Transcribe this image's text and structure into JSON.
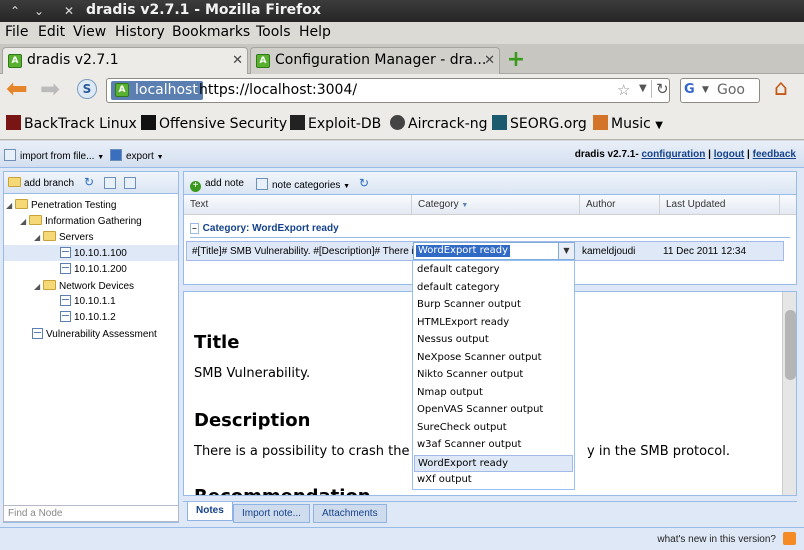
{
  "window": {
    "title": "dradis v2.7.1 - Mozilla Firefox"
  },
  "menu": [
    "File",
    "Edit",
    "View",
    "History",
    "Bookmarks",
    "Tools",
    "Help"
  ],
  "tabs": [
    {
      "label": "dradis v2.7.1"
    },
    {
      "label": "Configuration Manager - dra..."
    }
  ],
  "nav": {
    "host": "localhost",
    "url": "https://localhost:3004/",
    "search_placeholder": "Goo"
  },
  "bookmarks": [
    "BackTrack Linux",
    "Offensive Security",
    "Exploit-DB",
    "Aircrack-ng",
    "SEORG.org",
    "Music"
  ],
  "app": {
    "toolbar": {
      "import": "import from file...",
      "export": "export"
    },
    "brand": {
      "name": "dradis v2.7.1-",
      "configuration": "configuration",
      "sep1": "|",
      "logout": "logout",
      "sep2": "|",
      "feedback": "feedback"
    },
    "tree_toolbar": {
      "add_branch": "add branch"
    },
    "tree": [
      {
        "label": "Penetration Testing"
      },
      {
        "label": "Information Gathering"
      },
      {
        "label": "Servers"
      },
      {
        "label": "10.10.1.100"
      },
      {
        "label": "10.10.1.200"
      },
      {
        "label": "Network Devices"
      },
      {
        "label": "10.10.1.1"
      },
      {
        "label": "10.10.1.2"
      },
      {
        "label": "Vulnerability Assessment"
      }
    ],
    "find_placeholder": "Find a Node",
    "grid_toolbar": {
      "add_note": "add note",
      "categories": "note categories"
    },
    "grid": {
      "headers": [
        "Text",
        "Category",
        "Author",
        "Last Updated"
      ],
      "group": "Category: WordExport ready",
      "row": {
        "text": "#[Title]# SMB Vulnerability. #[Description]# There is",
        "category": "WordExport ready",
        "author": "kameldjoudi",
        "updated": "11 Dec 2011 12:34"
      }
    },
    "category_options": [
      "default category",
      "default category",
      "Burp Scanner output",
      "HTMLExport ready",
      "Nessus output",
      "NeXpose Scanner output",
      "Nikto Scanner output",
      "Nmap output",
      "OpenVAS Scanner output",
      "SureCheck output",
      "w3af Scanner output",
      "WordExport ready",
      "wXf output"
    ],
    "notes": {
      "title_h": "Title",
      "title_p": "SMB Vulnerability.",
      "desc_h": "Description",
      "desc_p": "There is a possibility to crash the h",
      "desc_p2": "y in the SMB protocol.",
      "rec_h": "Recommendation"
    },
    "bottom_tabs": [
      "Notes",
      "Import note...",
      "Attachments"
    ],
    "status": "what's new in this version?"
  }
}
